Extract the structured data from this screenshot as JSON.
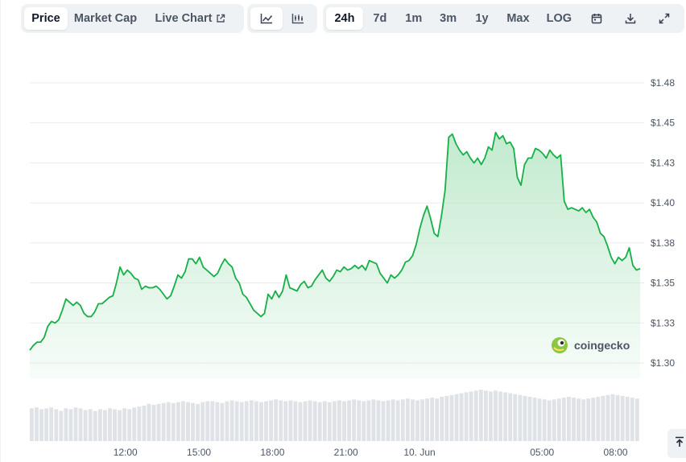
{
  "toolbar": {
    "views": [
      {
        "label": "Price",
        "active": true
      },
      {
        "label": "Market Cap",
        "active": false
      },
      {
        "label": "Live Chart",
        "active": false,
        "external": true
      }
    ],
    "chart_types": [
      {
        "icon": "line-chart-icon",
        "active": true
      },
      {
        "icon": "candlestick-chart-icon",
        "active": false
      }
    ],
    "ranges": [
      {
        "label": "24h",
        "active": true
      },
      {
        "label": "7d",
        "active": false
      },
      {
        "label": "1m",
        "active": false
      },
      {
        "label": "3m",
        "active": false
      },
      {
        "label": "1y",
        "active": false
      },
      {
        "label": "Max",
        "active": false
      },
      {
        "label": "LOG",
        "active": false
      }
    ],
    "actions": [
      "calendar-icon",
      "download-icon",
      "fullscreen-icon"
    ]
  },
  "watermark": "coingecko",
  "colors": {
    "line": "#16b047",
    "area_top": "#bfe9cc",
    "grid": "#e8ebef",
    "volume": "#dfe2e6",
    "toolbar_bg": "#eff2f5"
  },
  "chart_data": {
    "type": "area",
    "title": "",
    "xlabel": "",
    "ylabel": "",
    "ylim": [
      1.3,
      1.48
    ],
    "y_ticks": [
      "$1.30",
      "$1.33",
      "$1.35",
      "$1.38",
      "$1.40",
      "$1.43",
      "$1.45",
      "$1.48"
    ],
    "y_tick_values": [
      1.3,
      1.325,
      1.35,
      1.375,
      1.4,
      1.425,
      1.45,
      1.475
    ],
    "x_ticks": [
      "12:00",
      "15:00",
      "18:00",
      "21:00",
      "10. Jun",
      "05:00",
      "08:00"
    ],
    "x_tick_hours": [
      12,
      15,
      18,
      21,
      24,
      29,
      32
    ],
    "x_range_hours": [
      8.1,
      33.0
    ],
    "grid": true,
    "series": [
      {
        "values": [
          1.308,
          1.311,
          1.313,
          1.313,
          1.316,
          1.323,
          1.326,
          1.325,
          1.327,
          1.333,
          1.34,
          1.338,
          1.336,
          1.338,
          1.336,
          1.331,
          1.329,
          1.329,
          1.332,
          1.337,
          1.337,
          1.339,
          1.341,
          1.342,
          1.35,
          1.36,
          1.355,
          1.358,
          1.356,
          1.353,
          1.352,
          1.346,
          1.348,
          1.347,
          1.347,
          1.348,
          1.346,
          1.343,
          1.34,
          1.342,
          1.348,
          1.355,
          1.353,
          1.357,
          1.365,
          1.365,
          1.362,
          1.366,
          1.36,
          1.358,
          1.356,
          1.354,
          1.356,
          1.361,
          1.365,
          1.362,
          1.36,
          1.353,
          1.35,
          1.343,
          1.341,
          1.337,
          1.333,
          1.331,
          1.329,
          1.331,
          1.343,
          1.34,
          1.345,
          1.341,
          1.345,
          1.355,
          1.347,
          1.346,
          1.345,
          1.349,
          1.351,
          1.347,
          1.348,
          1.352,
          1.355,
          1.358,
          1.353,
          1.351,
          1.354,
          1.358,
          1.357,
          1.36,
          1.358,
          1.359,
          1.361,
          1.359,
          1.361,
          1.358,
          1.364,
          1.363,
          1.362,
          1.356,
          1.353,
          1.35,
          1.355,
          1.353,
          1.355,
          1.358,
          1.363,
          1.364,
          1.367,
          1.374,
          1.384,
          1.392,
          1.398,
          1.39,
          1.381,
          1.379,
          1.392,
          1.408,
          1.441,
          1.443,
          1.437,
          1.433,
          1.43,
          1.432,
          1.428,
          1.425,
          1.428,
          1.424,
          1.428,
          1.435,
          1.433,
          1.444,
          1.44,
          1.442,
          1.437,
          1.438,
          1.434,
          1.416,
          1.411,
          1.424,
          1.428,
          1.428,
          1.434,
          1.433,
          1.431,
          1.428,
          1.433,
          1.43,
          1.428,
          1.43,
          1.401,
          1.396,
          1.397,
          1.396,
          1.395,
          1.397,
          1.394,
          1.396,
          1.391,
          1.388,
          1.381,
          1.379,
          1.373,
          1.366,
          1.362,
          1.366,
          1.364,
          1.366,
          1.372,
          1.361,
          1.358,
          1.359
        ]
      }
    ],
    "volume": [
      0.37,
      0.38,
      0.36,
      0.37,
      0.38,
      0.36,
      0.34,
      0.37,
      0.36,
      0.38,
      0.37,
      0.35,
      0.36,
      0.34,
      0.36,
      0.35,
      0.37,
      0.36,
      0.35,
      0.37,
      0.36,
      0.38,
      0.39,
      0.4,
      0.42,
      0.41,
      0.42,
      0.43,
      0.44,
      0.43,
      0.44,
      0.45,
      0.44,
      0.43,
      0.42,
      0.44,
      0.45,
      0.45,
      0.44,
      0.43,
      0.45,
      0.46,
      0.45,
      0.44,
      0.45,
      0.46,
      0.45,
      0.44,
      0.45,
      0.46,
      0.47,
      0.46,
      0.45,
      0.46,
      0.45,
      0.44,
      0.45,
      0.46,
      0.45,
      0.44,
      0.45,
      0.44,
      0.45,
      0.46,
      0.45,
      0.46,
      0.47,
      0.46,
      0.45,
      0.46,
      0.47,
      0.46,
      0.45,
      0.46,
      0.47,
      0.46,
      0.47,
      0.48,
      0.47,
      0.46,
      0.47,
      0.48,
      0.49,
      0.48,
      0.5,
      0.51,
      0.52,
      0.53,
      0.54,
      0.55,
      0.56,
      0.57,
      0.58,
      0.57,
      0.56,
      0.57,
      0.56,
      0.55,
      0.54,
      0.53,
      0.52,
      0.51,
      0.5,
      0.49,
      0.48,
      0.47,
      0.46,
      0.47,
      0.48,
      0.49,
      0.5,
      0.49,
      0.48,
      0.47,
      0.48,
      0.49,
      0.5,
      0.51,
      0.52,
      0.53,
      0.52,
      0.51,
      0.5,
      0.49,
      0.48
    ]
  }
}
